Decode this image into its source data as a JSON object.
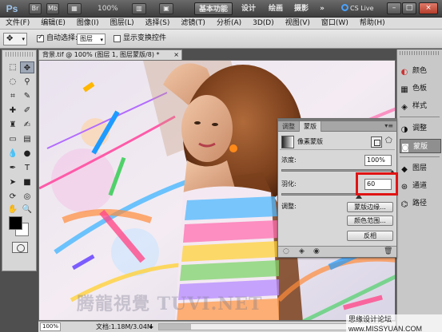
{
  "titlebar": {
    "app_logo": "Ps",
    "zoom": "100%",
    "workspaces": [
      "基本功能",
      "设计",
      "绘画",
      "摄影"
    ],
    "more": "»",
    "cslive": "CS Live",
    "win_min": "–",
    "win_max": "□",
    "win_close": "×"
  },
  "menubar": [
    "文件(F)",
    "编辑(E)",
    "图像(I)",
    "图层(L)",
    "选择(S)",
    "滤镜(T)",
    "分析(A)",
    "3D(D)",
    "视图(V)",
    "窗口(W)",
    "帮助(H)"
  ],
  "options": {
    "auto_select_label": "自动选择:",
    "auto_select_value": "图层",
    "show_transform_label": "显示变换控件",
    "auto_select_checked": true,
    "show_transform_checked": false
  },
  "document": {
    "tab_title": "背景.tif @ 100% (图层 1, 图层蒙版/8) *",
    "close": "×"
  },
  "statusbar": {
    "zoom": "100%",
    "doc_info": "文档:1.18M/3.04M",
    "arrow": "▸"
  },
  "dock": [
    {
      "label": "颜色",
      "icon": "color-icon"
    },
    {
      "label": "色板",
      "icon": "swatches-icon"
    },
    {
      "label": "样式",
      "icon": "styles-icon"
    },
    {
      "label": "调整",
      "icon": "adjustments-icon"
    },
    {
      "label": "蒙版",
      "icon": "masks-icon",
      "active": true
    },
    {
      "label": "图层",
      "icon": "layers-icon"
    },
    {
      "label": "通道",
      "icon": "channels-icon"
    },
    {
      "label": "路径",
      "icon": "paths-icon"
    }
  ],
  "masks_panel": {
    "tabs": [
      "调整",
      "蒙版"
    ],
    "active_tab": "蒙版",
    "menu": "▾≡",
    "mask_type": "像素蒙版",
    "density_label": "浓度:",
    "density_value": "100%",
    "density_level": 100,
    "feather_label": "羽化:",
    "feather_value": "60",
    "refine_label": "调整:",
    "mask_edge_button": "蒙版边缘...",
    "color_range_button": "颜色范围...",
    "invert_button": "反相"
  },
  "watermark": "腾龍視覺 TUVI.NET",
  "site_mark": "思缘设计论坛 www.MISSYUAN.COM",
  "colors": {
    "highlight": "#e01414",
    "foreground": "#000000",
    "background": "#ffffff"
  }
}
